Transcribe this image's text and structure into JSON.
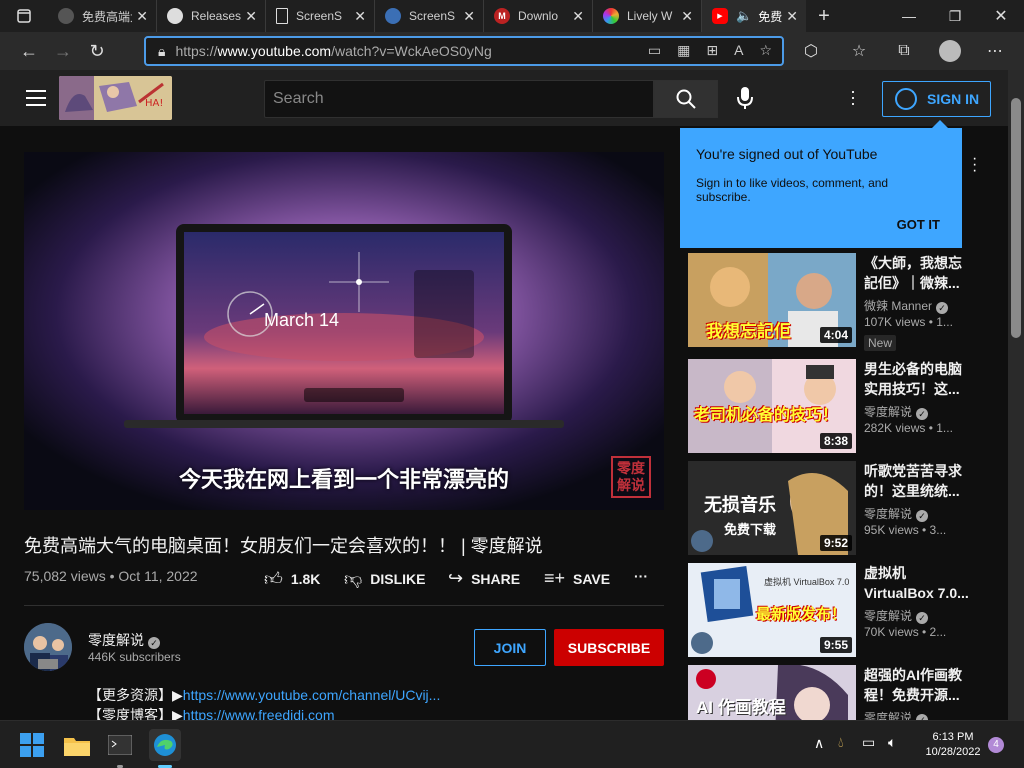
{
  "browser": {
    "tabs": [
      {
        "title": "免费高端大",
        "fav_color": "#555"
      },
      {
        "title": "Releases",
        "fav_color": "#333"
      },
      {
        "title": "ScreenS",
        "fav_color": "#444"
      },
      {
        "title": "ScreenS",
        "fav_color": "#1f4a8a"
      },
      {
        "title": "Downlo",
        "fav_color": "#b22"
      },
      {
        "title": "Lively W",
        "fav_color": "#7a4"
      },
      {
        "title": "免费",
        "fav_color": "#f00",
        "active": true
      }
    ],
    "url_scheme": "https://",
    "url_host": "www.youtube.com",
    "url_path": "/watch?v=WckAeOS0yNg"
  },
  "youtube": {
    "search_placeholder": "Search",
    "sign_in": "SIGN IN",
    "video": {
      "subtitle": "今天我在网上看到一个非常漂亮的",
      "watermark": "零度解说",
      "screen_date": "March 14",
      "title": "免费高端大气的电脑桌面！女朋友们一定会喜欢的！！ | 零度解说",
      "views": "75,082 views",
      "date": "Oct 11, 2022",
      "likes": "1.8K",
      "dislike": "DISLIKE",
      "share": "SHARE",
      "save": "SAVE"
    },
    "channel": {
      "name": "零度解说",
      "subs": "446K subscribers",
      "join": "JOIN",
      "subscribe": "SUBSCRIBE"
    },
    "description": [
      {
        "label": "【更多资源】▶",
        "link": "https://www.youtube.com/channel/UCvij..."
      },
      {
        "label": "【零度博客】▶",
        "link": "https://www.freedidi.com"
      }
    ],
    "popup": {
      "heading": "You're signed out of YouTube",
      "body": "Sign in to like videos, comment, and subscribe.",
      "action": "GOT IT"
    },
    "related": [
      {
        "title": "《大師，我想忘記佢》｜微辣...",
        "channel": "微辣 Manner",
        "views": "107K views • 1...",
        "duration": "4:04",
        "badge": "New",
        "thumb_text": "我想忘記佢"
      },
      {
        "title": "男生必备的电脑实用技巧！这...",
        "channel": "零度解说",
        "views": "282K views • 1...",
        "duration": "8:38",
        "thumb_text": "老司机必备的技巧！"
      },
      {
        "title": "听歌党苦苦寻求的！这里统统...",
        "channel": "零度解说",
        "views": "95K views • 3...",
        "duration": "9:52",
        "thumb_text": "无损音乐",
        "thumb_text2": "免费下载"
      },
      {
        "title": "虚拟机 VirtualBox 7.0...",
        "channel": "零度解说",
        "views": "70K views • 2...",
        "duration": "9:55",
        "thumb_text": "最新版发布！",
        "thumb_text2": "虚拟机 VirtualBox 7.0"
      },
      {
        "title": "超强的AI作画教程！免费开源...",
        "channel": "零度解说",
        "views": "",
        "duration": "",
        "thumb_text": "AI 作画教程"
      }
    ]
  },
  "taskbar": {
    "time": "6:13 PM",
    "date": "10/28/2022",
    "notifications": "4"
  }
}
